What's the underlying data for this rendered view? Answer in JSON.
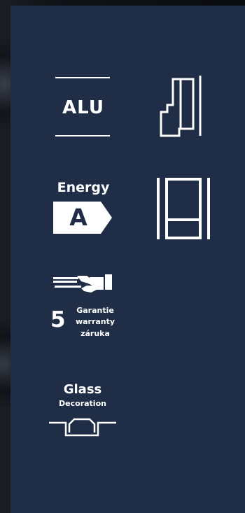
{
  "badges": {
    "material": {
      "label": "ALU"
    },
    "energy": {
      "title": "Energy",
      "class": "A"
    },
    "warranty": {
      "years": "5",
      "line1": "Garantie",
      "line2": "warranty",
      "line3": "záruka"
    },
    "glass": {
      "title": "Glass",
      "subtitle": "Decoration"
    }
  },
  "icons": {
    "material": "alu-badge",
    "profile": "window-profile-icon",
    "frame": "window-frame-icon",
    "energy": "energy-class-arrow-icon",
    "warranty": "handshake-icon",
    "glass": "glass-decoration-icon"
  },
  "colors": {
    "panel": "#1f2e46",
    "foreground": "#ffffff",
    "backdrop": "#0d0e12"
  }
}
